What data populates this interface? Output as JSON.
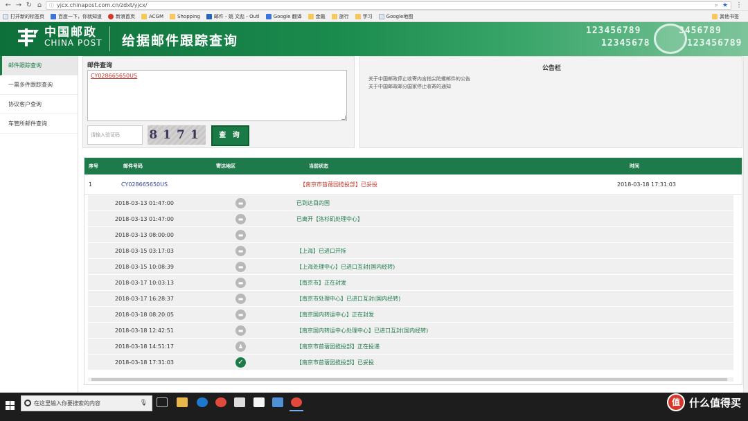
{
  "browser": {
    "url": "yjcx.chinapost.com.cn/zdxt/yjcx/",
    "bookmarks": [
      {
        "label": "打开新的标签页",
        "icon": "page-icon"
      },
      {
        "label": "百度一下，你就知道",
        "icon": "baidu-icon"
      },
      {
        "label": "新浪首页",
        "icon": "sina-icon"
      },
      {
        "label": "ACGM",
        "icon": "folder-icon"
      },
      {
        "label": "Shopping",
        "icon": "folder-icon"
      },
      {
        "label": "邮件 - 姚 文彪 - Outl",
        "icon": "outlook-icon"
      },
      {
        "label": "Google 翻译",
        "icon": "translate-icon"
      },
      {
        "label": "金融",
        "icon": "folder-icon"
      },
      {
        "label": "旅行",
        "icon": "folder-icon"
      },
      {
        "label": "学习",
        "icon": "folder-icon"
      },
      {
        "label": "Google地图",
        "icon": "page-icon"
      }
    ],
    "other_bookmarks": "其他书签"
  },
  "header": {
    "logo_cn": "中国邮政",
    "logo_en": "CHINA POST",
    "title": "给据邮件跟踪查询",
    "digits_top": "123456789",
    "digits_top_right": "3456789",
    "digits_bottom": "12345678",
    "digits_bottom_right": "123456789"
  },
  "sidebar": {
    "items": [
      {
        "label": "邮件跟踪查询",
        "active": true
      },
      {
        "label": "一票多件跟踪查询",
        "active": false
      },
      {
        "label": "协议客户查询",
        "active": false
      },
      {
        "label": "车管所邮件查询",
        "active": false
      }
    ]
  },
  "query": {
    "title": "邮件查询",
    "tracking_value": "CY028665650US",
    "captcha_placeholder": "请输入验证码",
    "captcha_text": "8171",
    "submit_label": "查 询"
  },
  "notice": {
    "title": "公告栏",
    "items": [
      "关于中国邮政停止收寄内含指尖陀螺邮件的公告",
      "关于中国邮政邮分国家停止收寄的通知"
    ]
  },
  "results": {
    "columns": [
      "序号",
      "邮件号码",
      "寄达地区",
      "当前状态",
      "时间"
    ],
    "main_row": {
      "no": "1",
      "number": "CY028665650US",
      "region": "",
      "status": "【南京市苜蓿园揽投部】已妥投",
      "time": "2018-03-18 17:31:03"
    },
    "details": [
      {
        "time": "2018-03-13 01:47:00",
        "text": "已到达目的国",
        "done": false
      },
      {
        "time": "2018-03-13 01:47:00",
        "text": "已离开【洛杉矶处理中心】",
        "done": false
      },
      {
        "time": "2018-03-13 08:00:00",
        "text": "",
        "done": false
      },
      {
        "time": "2018-03-15 03:17:03",
        "text": "【上海】已进口开拆",
        "done": false
      },
      {
        "time": "2018-03-15 10:08:39",
        "text": "【上海处理中心】已进口互封(国内经转)",
        "done": false
      },
      {
        "time": "2018-03-17 10:03:13",
        "text": "【南京市】正在封发",
        "done": false
      },
      {
        "time": "2018-03-17 16:28:37",
        "text": "【南京市处理中心】已进口互封(国内经转)",
        "done": false
      },
      {
        "time": "2018-03-18 08:20:05",
        "text": "【南京国内转运中心】正在封发",
        "done": false
      },
      {
        "time": "2018-03-18 12:42:51",
        "text": "【南京国内转运中心处理中心】已进口互封(国内经转)",
        "done": false
      },
      {
        "time": "2018-03-18 14:51:17",
        "text": "【南京市苜蓿园揽投部】正在投递",
        "done": false
      },
      {
        "time": "2018-03-18 17:31:03",
        "text": "【南京市苜蓿园揽投部】已妥投",
        "done": true
      }
    ]
  },
  "taskbar": {
    "search_placeholder": "在这里输入你要搜索的内容",
    "watermark": "什么值得买",
    "watermark_badge": "值"
  },
  "colors": {
    "brand_green": "#1a7a45",
    "status_red": "#c0392b",
    "detail_green": "#1f7a4b"
  }
}
